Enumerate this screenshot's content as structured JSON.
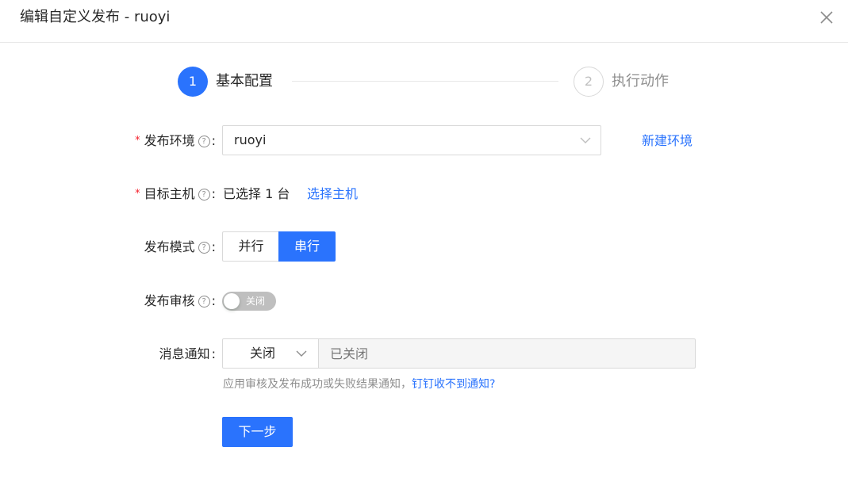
{
  "modal": {
    "title": "编辑自定义发布 - ruoyi"
  },
  "steps": [
    {
      "number": "1",
      "title": "基本配置",
      "status": "active"
    },
    {
      "number": "2",
      "title": "执行动作",
      "status": "wait"
    }
  ],
  "form": {
    "env": {
      "label": "发布环境",
      "required": true,
      "value": "ruoyi",
      "link": "新建环境"
    },
    "host": {
      "label": "目标主机",
      "required": true,
      "selected_text": "已选择 1 台",
      "link": "选择主机"
    },
    "mode": {
      "label": "发布模式",
      "options": [
        "并行",
        "串行"
      ],
      "selected": "串行"
    },
    "review": {
      "label": "发布审核",
      "switch_text": "关闭",
      "enabled": false
    },
    "notify": {
      "label": "消息通知",
      "select_value": "关闭",
      "input_placeholder": "已关闭",
      "help_text": "应用审核及发布成功或失败结果通知，",
      "help_link": "钉钉收不到通知?"
    },
    "next_button": "下一步"
  },
  "colors": {
    "primary": "#2a73fd",
    "required": "#f5222d",
    "border": "#d9d9d9"
  },
  "icons": {
    "help": "question-circle-icon",
    "close": "close-icon",
    "select_arrow": "chevron-down-icon"
  }
}
